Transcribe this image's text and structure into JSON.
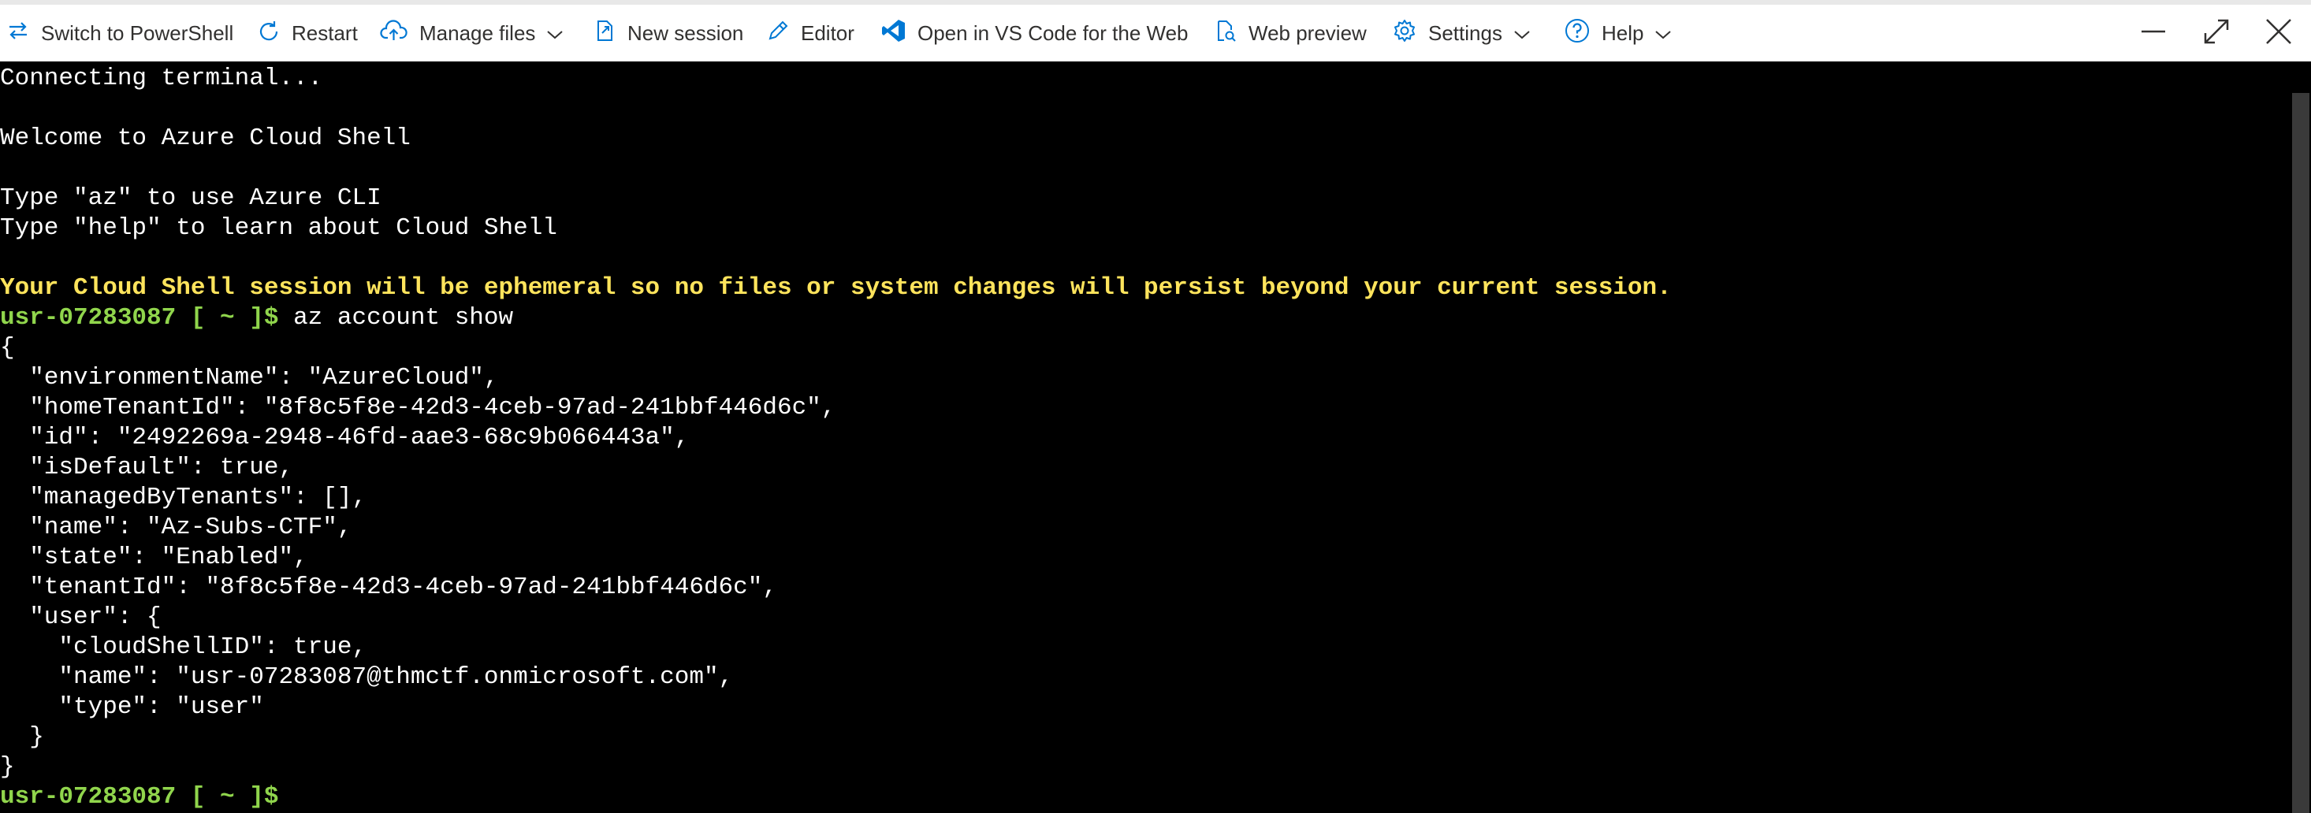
{
  "toolbar": {
    "switch_label": "Switch to PowerShell",
    "restart_label": "Restart",
    "manage_files_label": "Manage files",
    "new_session_label": "New session",
    "editor_label": "Editor",
    "vscode_label": "Open in VS Code for the Web",
    "web_preview_label": "Web preview",
    "settings_label": "Settings",
    "help_label": "Help"
  },
  "icons": {
    "switch": "switch-arrows-icon",
    "restart": "restart-icon",
    "manage_files": "cloud-upload-icon",
    "new_session": "new-session-icon",
    "editor": "pencil-icon",
    "vscode": "vscode-icon",
    "web_preview": "web-preview-icon",
    "settings": "gear-icon",
    "help": "help-circle-icon",
    "minimize": "minimize-icon",
    "maximize": "maximize-icon",
    "close": "close-icon"
  },
  "colors": {
    "accent": "#0078d4",
    "prompt": "#90d54c",
    "warning": "#ffe45c",
    "terminal_bg": "#000000",
    "terminal_fg": "#ffffff"
  },
  "terminal": {
    "connecting": "Connecting terminal...",
    "welcome": "Welcome to Azure Cloud Shell",
    "hint_az": "Type \"az\" to use Azure CLI",
    "hint_help": "Type \"help\" to learn about Cloud Shell",
    "warning": "Your Cloud Shell session will be ephemeral so no files or system changes will persist beyond your current session.",
    "prompt": "usr-07283087 [ ~ ]$",
    "command": " az account show",
    "output": [
      "{",
      "  \"environmentName\": \"AzureCloud\",",
      "  \"homeTenantId\": \"8f8c5f8e-42d3-4ceb-97ad-241bbf446d6c\",",
      "  \"id\": \"2492269a-2948-46fd-aae3-68c9b066443a\",",
      "  \"isDefault\": true,",
      "  \"managedByTenants\": [],",
      "  \"name\": \"Az-Subs-CTF\",",
      "  \"state\": \"Enabled\",",
      "  \"tenantId\": \"8f8c5f8e-42d3-4ceb-97ad-241bbf446d6c\",",
      "  \"user\": {",
      "    \"cloudShellID\": true,",
      "    \"name\": \"usr-07283087@thmctf.onmicrosoft.com\",",
      "    \"type\": \"user\"",
      "  }",
      "}"
    ],
    "final_prompt": "usr-07283087 [ ~ ]$"
  }
}
